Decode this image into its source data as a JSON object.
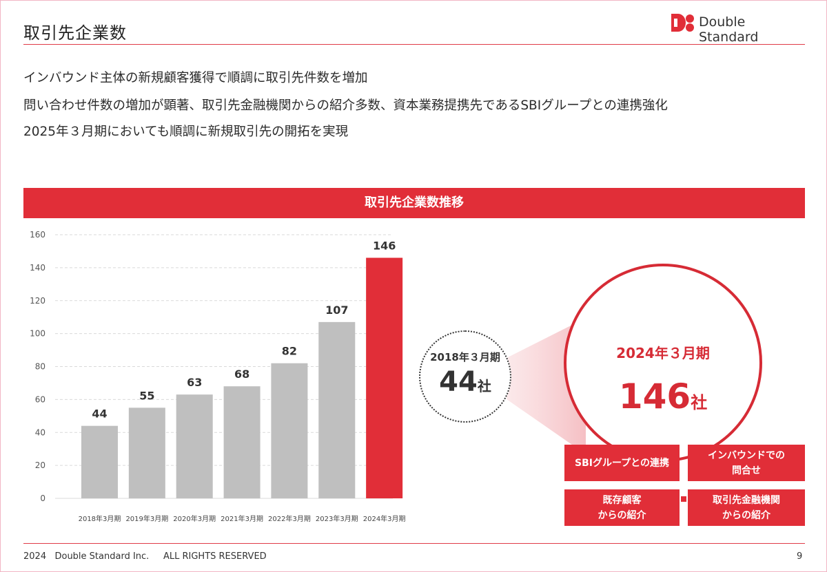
{
  "page": {
    "title": "取引先企業数",
    "brand": "Double Standard",
    "lines": [
      "インバウンド主体の新規顧客獲得で順調に取引先件数を増加",
      "問い合わせ件数の増加が顕著、取引先金融機関からの紹介多数、資本業務提携先であるSBIグループとの連携強化",
      "2025年３月期においても順調に新規取引先の開拓を実現"
    ],
    "banner": "取引先企業数推移",
    "footer": "2024   Double Standard Inc.     ALL RIGHTS RESERVED",
    "page_number": "9"
  },
  "comparison": {
    "before_period": "2018年３月期",
    "before_count": "44",
    "after_period": "2024年３月期",
    "after_count": "146",
    "unit": "社"
  },
  "factors": [
    "SBIグループとの連携",
    "インバウンドでの\n問合せ",
    "既存顧客\nからの紹介",
    "取引先金融機関\nからの紹介"
  ],
  "colors": {
    "accent": "#e12e38",
    "bar_gray": "#bfbfbf",
    "bar_highlight": "#e12e38"
  },
  "chart_data": {
    "type": "bar",
    "title": "取引先企業数推移",
    "categories": [
      "2018年3月期",
      "2019年3月期",
      "2020年3月期",
      "2021年3月期",
      "2022年3月期",
      "2023年3月期",
      "2024年3月期"
    ],
    "values": [
      44,
      55,
      63,
      68,
      82,
      107,
      146
    ],
    "highlight_index": 6,
    "ylim": [
      0,
      160
    ],
    "yticks": [
      0,
      20,
      40,
      60,
      80,
      100,
      120,
      140,
      160
    ],
    "grid": true,
    "xlabel": "",
    "ylabel": ""
  }
}
